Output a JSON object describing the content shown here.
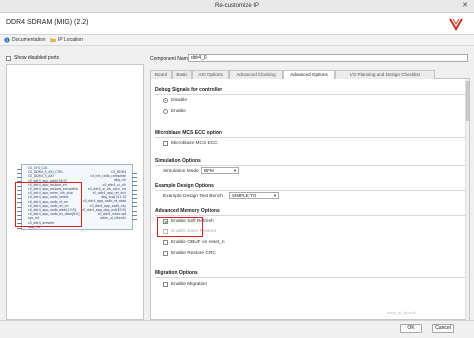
{
  "window": {
    "title": "Re-customize IP"
  },
  "header": {
    "ip_name": "DDR4 SDRAM (MIG) (2.2)"
  },
  "toolbar": {
    "documentation": "Documentation",
    "ip_location": "IP Location"
  },
  "left": {
    "show_disabled_ports": "Show disabled ports",
    "block": {
      "left_ports": [
        "C0_SYS_CLK",
        "C0_DDR4_S_AXI_CTRL",
        "C0_DDR4_S_AXI",
        "c0_ddr4_app_addr[28:0]",
        "c0_ddr4_app_restore_en",
        "c0_ddr4_app_restore_complete",
        "c0_ddr4_app_mem_init_skip",
        "c0_ddr4_app_xsdb_select",
        "c0_ddr4_app_xsdb_rd_en",
        "c0_ddr4_app_xsdb_wr_en",
        "c0_ddr4_app_xsdb_addr[15:0]",
        "c0_ddr4_app_xsdb_wr_data[8:0]",
        "sys_rst",
        "c0_ddr4_aresetn",
        "app_rdt"
      ],
      "right_ports": [
        "C0_DDR4",
        "c0_init_calib_complete",
        "dbg_clk",
        "c0_ddr4_ui_clk",
        "c0_ddr4_ui_clk_sync_rst",
        "c0_ddr4_app_ref_ack",
        "dbg_bus[511:0]",
        "c0_ddr4_app_xsdb_rd_data",
        "c0_ddr4_app_xsdb_rdy",
        "c0_ddr4_app_dbg_out[63:0]",
        "c0_ddr4_interrupt",
        "addn_ui_clkout1"
      ]
    }
  },
  "right": {
    "component_name_label": "Component Name",
    "component_name_value": "ddr4_0",
    "tabs": [
      "Board",
      "Basic",
      "AXI Options",
      "Advanced Clocking",
      "Advanced Options",
      "I/O Planning and Design Checklist"
    ],
    "debug": {
      "title": "Debug Signals for controller",
      "disable": "Disable",
      "enable": "Enable"
    },
    "microblaze": {
      "title": "Microblaze MCS ECC option",
      "option": "Microblaze MCS ECC"
    },
    "simulation": {
      "title": "Simulation Options",
      "mode_label": "Simulation Mode",
      "mode_value": "BFM"
    },
    "example": {
      "title": "Example Design Options",
      "label": "Example Design Test Bench",
      "value": "SIMPLE TG"
    },
    "advanced": {
      "title": "Advanced Memory Options",
      "self_refresh": "Enable Self Refresh",
      "save_restore": "Enable Save Restore",
      "obuf": "Enable OBUF on reset_n",
      "restore_crc": "Enable Restore CRC"
    },
    "migration": {
      "title": "Migration Options",
      "option": "Enable Migration"
    }
  },
  "footer": {
    "ok": "OK",
    "cancel": "Cancel"
  },
  "watermark": "addn_ui_clkout1",
  "colors": {
    "highlight": "#e02020",
    "accent": "#2a62b8"
  }
}
